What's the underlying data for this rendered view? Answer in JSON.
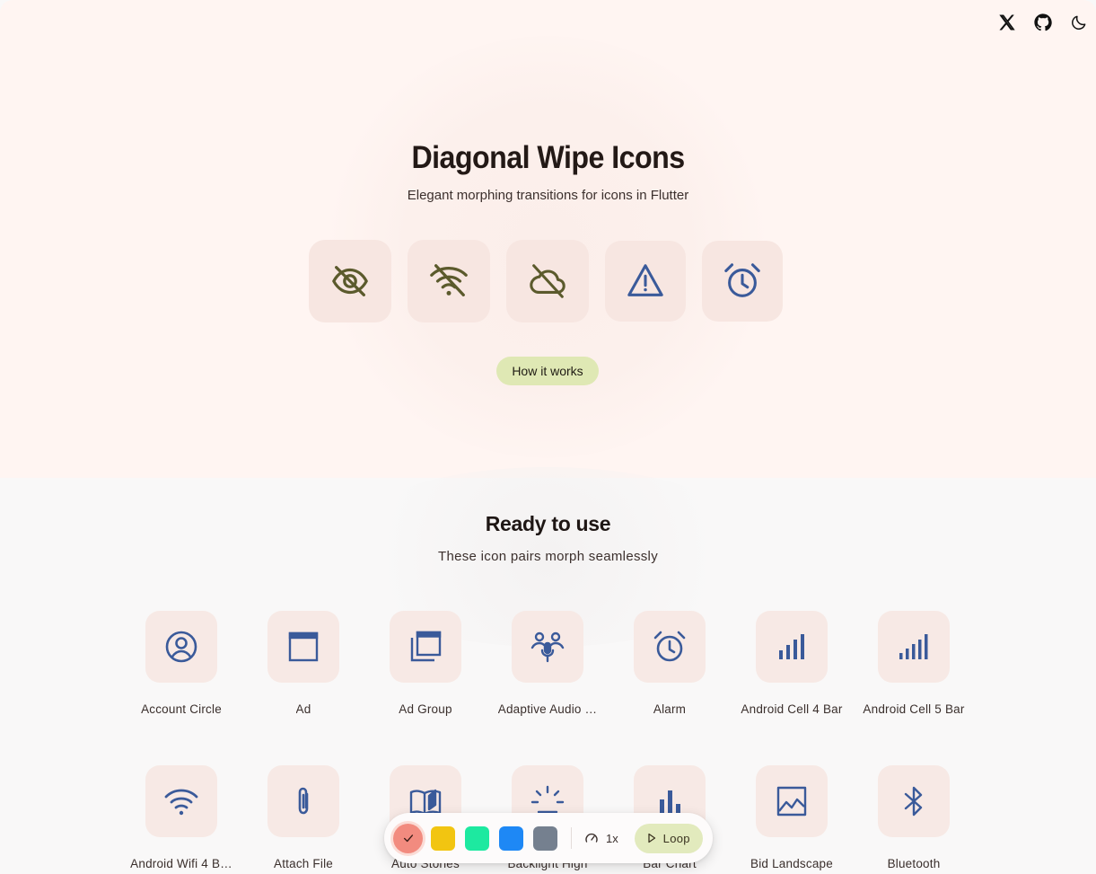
{
  "topbar": {
    "icons": [
      "x-logo-icon",
      "github-icon",
      "moon-icon"
    ]
  },
  "hero": {
    "title": "Diagonal Wipe Icons",
    "subtitle": "Elegant morphing transitions for icons in Flutter",
    "icons": [
      "visibility-off-icon",
      "wifi-off-icon",
      "cloud-off-icon",
      "warning-icon",
      "alarm-icon"
    ],
    "button_label": "How it works"
  },
  "section": {
    "title": "Ready to use",
    "subtitle": "These icon pairs morph seamlessly"
  },
  "icons_row1": [
    {
      "label": "Account Circle",
      "icon": "account-circle-icon"
    },
    {
      "label": "Ad",
      "icon": "ad-icon"
    },
    {
      "label": "Ad Group",
      "icon": "ad-group-icon"
    },
    {
      "label": "Adaptive Audio …",
      "icon": "adaptive-audio-mic-icon"
    },
    {
      "label": "Alarm",
      "icon": "alarm-icon"
    },
    {
      "label": "Android Cell 4 Bar",
      "icon": "cell-4-bar-icon"
    },
    {
      "label": "Android Cell 5 Bar",
      "icon": "cell-5-bar-icon"
    }
  ],
  "icons_row2": [
    {
      "label": "Android Wifi 4 B…",
      "icon": "wifi-4-bar-icon"
    },
    {
      "label": "Attach File",
      "icon": "attach-file-icon"
    },
    {
      "label": "Auto Stories",
      "icon": "auto-stories-icon"
    },
    {
      "label": "Backlight High",
      "icon": "backlight-high-icon"
    },
    {
      "label": "Bar Chart",
      "icon": "bar-chart-icon"
    },
    {
      "label": "Bid Landscape",
      "icon": "bid-landscape-icon"
    },
    {
      "label": "Bluetooth",
      "icon": "bluetooth-icon"
    }
  ],
  "toolbar": {
    "colors": [
      "#f28b7f",
      "#f2c511",
      "#1de9a0",
      "#1e88f5",
      "#75808f"
    ],
    "selected_color_index": 0,
    "speed_label": "1x",
    "loop_label": "Loop"
  },
  "colors": {
    "hero_accent": "#5b5a2c",
    "icon_blue": "#3a5a9a",
    "tile_bg": "#f7e9e5",
    "button_bg": "#dfe8b4"
  }
}
